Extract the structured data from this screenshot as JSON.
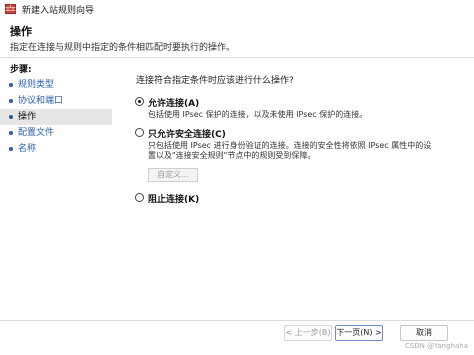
{
  "window": {
    "title": "新建入站规则向导",
    "icon": "firewall-rule-icon"
  },
  "header": {
    "title": "操作",
    "description": "指定在连接与规则中指定的条件相匹配时要执行的操作。"
  },
  "nav": {
    "steps_label": "步骤:",
    "items": [
      {
        "label": "规则类型"
      },
      {
        "label": "协议和端口"
      },
      {
        "label": "操作"
      },
      {
        "label": "配置文件"
      },
      {
        "label": "名称"
      }
    ],
    "current_index": 2
  },
  "content": {
    "prompt": "连接符合指定条件时应该进行什么操作?",
    "options": [
      {
        "label": "允许连接(A)",
        "desc_lines": [
          "包括使用 IPsec 保护的连接，以及未使用 IPsec 保护的连接。"
        ],
        "checked": true
      },
      {
        "label": "只允许安全连接(C)",
        "desc_lines": [
          "只包括使用 IPsec 进行身份验证的连接。连接的安全性将依照 IPsec 属性中的设",
          "置以及\"连接安全规则\"节点中的规则受到保障。"
        ],
        "checked": false
      },
      {
        "label": "阻止连接(K)",
        "desc_lines": [],
        "checked": false
      }
    ],
    "customize_button": "自定义..."
  },
  "footer": {
    "back": "< 上一步(B)",
    "next": "下一页(N) >",
    "cancel": "取消"
  },
  "watermark": "CSDN @Yanghaha"
}
